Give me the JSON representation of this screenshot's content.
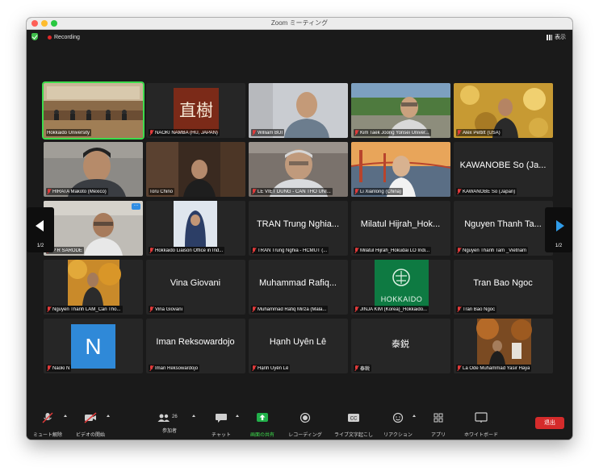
{
  "window": {
    "title": "Zoom ミーティング"
  },
  "topbar": {
    "recording_label": "Recording",
    "view_label": "表示"
  },
  "navigation": {
    "left_page": "1/2",
    "right_page": "1/2"
  },
  "participants": [
    {
      "display": "",
      "label": "Hokkaido University",
      "active": true
    },
    {
      "display": "直樹",
      "label": "NAOKI NAMBA (HU, JAPAN)"
    },
    {
      "display": "",
      "label": "William BUI"
    },
    {
      "display": "",
      "label": "Kim Taek Joong Yonsei Univer..."
    },
    {
      "display": "",
      "label": "Alex Pettitt (USA)"
    },
    {
      "display": "",
      "label": "HIRATA Makoto (Mexico)"
    },
    {
      "display": "",
      "label": "Toru Chino"
    },
    {
      "display": "",
      "label": "LE VIET DUNG - CAN THO UNI..."
    },
    {
      "display": "",
      "label": "Li Xianlong (China)"
    },
    {
      "display": "KAWANOBE So (Ja...",
      "label": "KAWANOBE So (Japan)"
    },
    {
      "display": "",
      "label": "P R SARODE"
    },
    {
      "display": "",
      "label": "Hokkaido Liaison Office in Ind..."
    },
    {
      "display": "TRAN Trung Nghia...",
      "label": "TRAN Trung Nghia - HCMUT (..."
    },
    {
      "display": "Milatul Hijrah_Hok...",
      "label": "Milatul Hijrah_Hokudai LO Indi..."
    },
    {
      "display": "Nguyen Thanh Ta...",
      "label": "Nguyen Thanh Tam _Vietnam"
    },
    {
      "display": "",
      "label": "Nguyen Thanh LAM_Can Tho..."
    },
    {
      "display": "Vina Giovani",
      "label": "Vina Giovani"
    },
    {
      "display": "Muhammad Rafiq...",
      "label": "Muhammad Rafiq Mirza (Mala..."
    },
    {
      "display": "HOKKAIDO",
      "label": "JINJA KIM (Korea)_Hokkaido..."
    },
    {
      "display": "Tran Bao Ngoc",
      "label": "Tran Bao Ngoc"
    },
    {
      "display": "N",
      "label": "Naoki N"
    },
    {
      "display": "Iman Reksowardojo",
      "label": "Iman Reksowardojo"
    },
    {
      "display": "Hạnh Uyên Lê",
      "label": "Hạnh Uyên Lê"
    },
    {
      "display": "泰鋭",
      "label": "泰鋭"
    },
    {
      "display": "",
      "label": "La Ode Muhammad Yasir Haya"
    }
  ],
  "toolbar": {
    "mute": "ミュート解除",
    "video": "ビデオの開始",
    "participants": "参加者",
    "participants_count": "26",
    "chat": "チャット",
    "share": "画面の共有",
    "record": "レコーディング",
    "cc": "ライブ文字起こし",
    "reactions": "リアクション",
    "apps": "アプリ",
    "whiteboard": "ホワイトボード",
    "leave": "退出"
  },
  "colors": {
    "accent_green": "#3ddc4c",
    "leave_red": "#d52b2b",
    "avatar_blue": "#2f89d8",
    "nav_blue": "#2f9be8"
  }
}
